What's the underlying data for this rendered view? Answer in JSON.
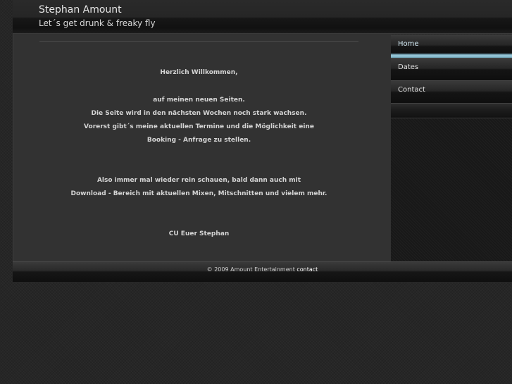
{
  "header": {
    "title": "Stephan Amount",
    "tagline": "Let´s get drunk & freaky fly"
  },
  "nav": {
    "items": [
      {
        "label": "Home",
        "active": true
      },
      {
        "label": "Dates",
        "active": false
      },
      {
        "label": "Contact",
        "active": false
      }
    ]
  },
  "content": {
    "welcome": "Herzlich Willkommen,",
    "line1": "auf meinen neuen Seiten.",
    "line2": "Die Seite wird in den nächsten Wochen noch stark wachsen.",
    "line3": "Vorerst gibt´s meine aktuellen Termine und die Möglichkeit eine",
    "line4": "Booking - Anfrage zu stellen.",
    "line5": "Also immer mal wieder rein schauen, bald dann auch mit",
    "line6": "Download - Bereich mit aktuellen Mixen, Mitschnitten und vielem mehr.",
    "signoff": "CU Euer Stephan"
  },
  "footer": {
    "copyright": "© 2009 Amount Entertainment",
    "contact_link": "contact"
  }
}
